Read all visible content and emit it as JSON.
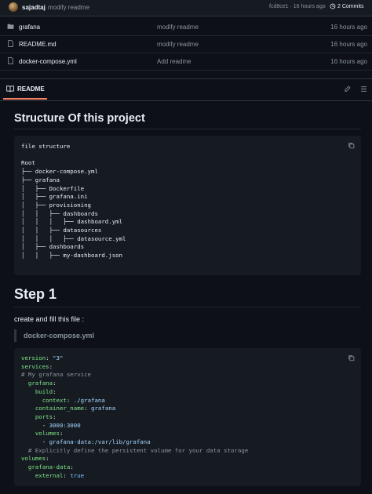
{
  "commit_bar": {
    "author": "sajadtaj",
    "message": "modify readme",
    "meta": "fcd8ce1 · 16 hours ago",
    "commits": "2 Commits"
  },
  "files": [
    {
      "name": "grafana",
      "type": "folder",
      "message": "modify readme",
      "time": "16 hours ago"
    },
    {
      "name": "README.md",
      "type": "file",
      "message": "modify readme",
      "time": "16 hours ago"
    },
    {
      "name": "docker-compose.yml",
      "type": "file",
      "message": "Add readme",
      "time": "16 hours ago"
    }
  ],
  "readme": {
    "tab_label": "README",
    "heading1": "Structure Of this project",
    "tree_code": "file structure\n\nRoot\n├── docker-compose.yml\n├── grafana\n│   ├── Dockerfile\n│   ├── grafana.ini\n│   ├── provisioning\n│   │   ├── dashboards\n│   │   │   ├── dashboard.yml\n│   │   ├── datasources\n│   │   │   ├── datasource.yml\n│   ├── dashboards\n│   │   ├── my-dashboard.json",
    "heading2": "Step 1",
    "paragraph": "create and fill this file :",
    "quote": "docker-compose.yml",
    "yaml": {
      "l1k": "version",
      "l1v": "\"3\"",
      "l2k": "services",
      "l3c": "# My grafana service",
      "l4k": "grafana",
      "l5k": "build",
      "l6k": "context",
      "l6v": "./grafana",
      "l7k": "container_name",
      "l7v": "grafana",
      "l8k": "ports",
      "l9v": "3000:3000",
      "l10k": "volumes",
      "l11v": "grafana-data:/var/lib/grafana",
      "l12c": "# Explicitly define the persistent volume for your data storage",
      "l13k": "volumes",
      "l14k": "grafana-data",
      "l15k": "external",
      "l15v": "true"
    }
  },
  "colors": {
    "background": "#0d1117",
    "accent": "#f78166",
    "yaml_key": "#7ee787",
    "yaml_string": "#a5d6ff"
  }
}
